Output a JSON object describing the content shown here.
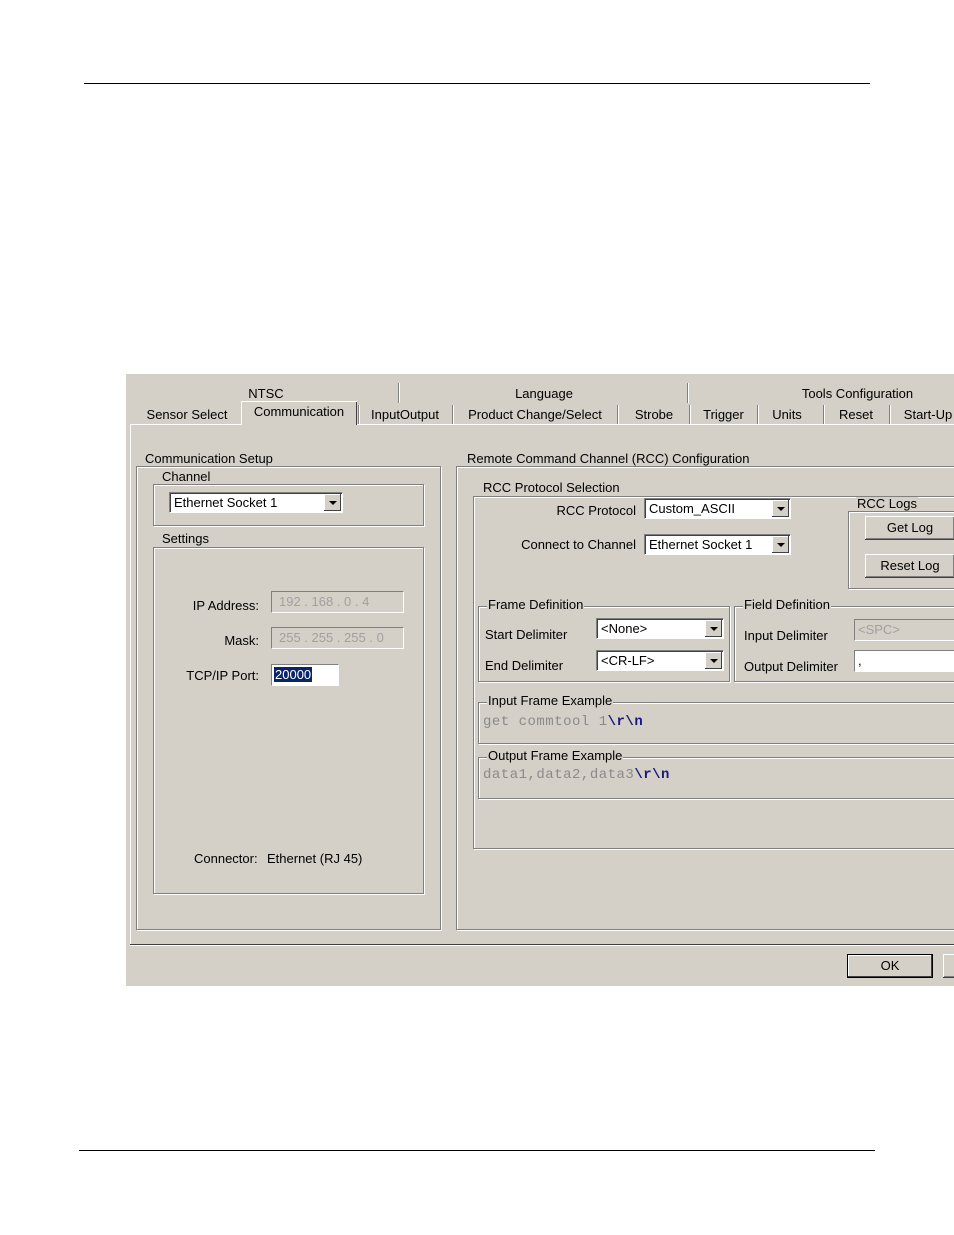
{
  "tabs_row1": [
    "NTSC",
    "Language",
    "Tools Configuration"
  ],
  "tabs_row2": [
    "Sensor Select",
    "Communication",
    "InputOutput",
    "Product Change/Select",
    "Strobe",
    "Trigger",
    "Units",
    "Reset",
    "Start-Up"
  ],
  "comm_setup": {
    "title": "Communication Setup",
    "channel_label": "Channel",
    "channel_value": "Ethernet Socket 1",
    "settings_label": "Settings",
    "ip_label": "IP Address:",
    "ip_value": "192 . 168 .  0  .  4",
    "mask_label": "Mask:",
    "mask_value": "255 . 255 . 255 .  0",
    "port_label": "TCP/IP Port:",
    "port_value": "20000",
    "connector_label": "Connector:",
    "connector_value": "Ethernet (RJ 45)"
  },
  "rcc": {
    "title": "Remote Command Channel (RCC) Configuration",
    "protocol_group": "RCC Protocol  Selection",
    "protocol_label": "RCC Protocol",
    "protocol_value": "Custom_ASCII",
    "connect_label": "Connect to Channel",
    "connect_value": "Ethernet Socket 1",
    "logs_title": "RCC Logs",
    "get_log": "Get Log",
    "reset_log": "Reset Log",
    "frame_def": "Frame Definition",
    "start_delim_label": "Start Delimiter",
    "start_delim_value": "<None>",
    "end_delim_label": "End Delimiter",
    "end_delim_value": "<CR-LF>",
    "field_def": "Field Definition",
    "input_delim_label": "Input Delimiter",
    "input_delim_value": "<SPC>",
    "output_delim_label": "Output Delimiter",
    "output_delim_value": ",",
    "input_example_title": "Input Frame Example",
    "input_example_text": "get commtool 1",
    "input_example_term": "\\r\\n",
    "output_example_title": "Output Frame Example",
    "output_example_text": "data1,data2,data3",
    "output_example_term": "\\r\\n"
  },
  "ok_button": "OK"
}
